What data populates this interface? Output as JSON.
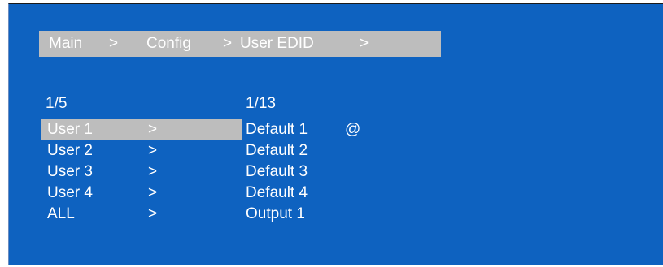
{
  "breadcrumb": {
    "items": [
      "Main",
      "Config",
      "User EDID"
    ],
    "separator": ">"
  },
  "left_column": {
    "counter": "1/5",
    "items": [
      {
        "label": "User 1",
        "arrow": ">",
        "selected": true
      },
      {
        "label": "User 2",
        "arrow": ">"
      },
      {
        "label": "User 3",
        "arrow": ">"
      },
      {
        "label": "User 4",
        "arrow": ">"
      },
      {
        "label": "ALL",
        "arrow": ">"
      }
    ]
  },
  "right_column": {
    "counter": "1/13",
    "items": [
      {
        "label": "Default 1",
        "marker": "@"
      },
      {
        "label": "Default 2"
      },
      {
        "label": "Default 3"
      },
      {
        "label": "Default 4"
      },
      {
        "label": "Output 1"
      }
    ]
  },
  "colors": {
    "background": "#0e62c0",
    "highlight": "#bdbdbd",
    "text": "#ffffff"
  }
}
